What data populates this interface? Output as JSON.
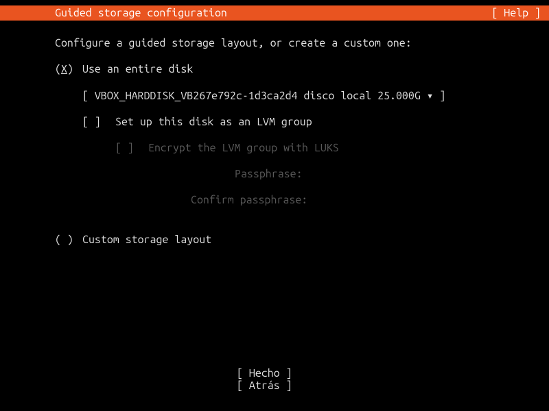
{
  "header": {
    "title": "Guided storage configuration",
    "help": "[ Help ]"
  },
  "prompt": "Configure a guided storage layout, or create a custom one:",
  "entire_disk": {
    "marker_open": "(",
    "marker_x": "X",
    "marker_close": ")",
    "label": "Use an entire disk",
    "disk_selector": "[ VBOX_HARDDISK_VB267e792c-1d3ca2d4 disco local 25.000G ▾ ]",
    "lvm": {
      "marker": "[ ]",
      "label": "Set up this disk as an LVM group",
      "encrypt": {
        "marker": "[ ]",
        "label": "Encrypt the LVM group with LUKS",
        "passphrase_label": "Passphrase:",
        "confirm_label": "Confirm passphrase:"
      }
    }
  },
  "custom": {
    "marker": "( )",
    "label": "Custom storage layout"
  },
  "footer": {
    "done": "[ Hecho    ]",
    "back": "[ Atrás    ]"
  }
}
